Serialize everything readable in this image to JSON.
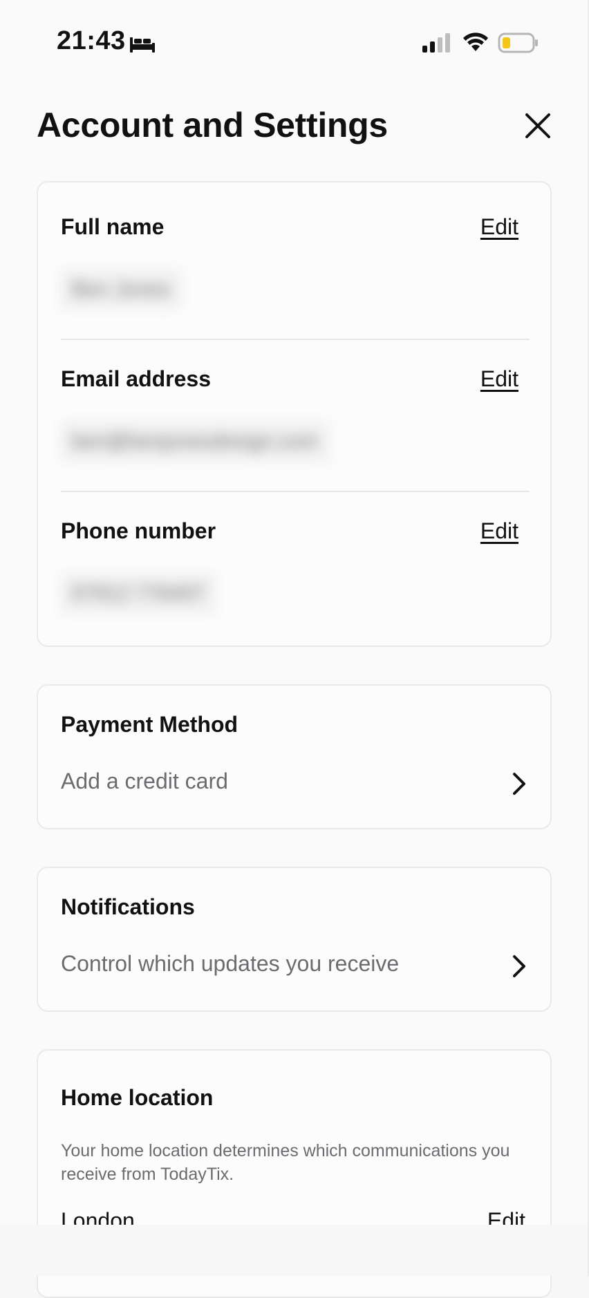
{
  "status_bar": {
    "time": "21:43",
    "icons": [
      "bed-icon",
      "cellular-signal-icon",
      "wifi-icon",
      "battery-icon"
    ],
    "battery_color": "#f5c518"
  },
  "header": {
    "title": "Account and Settings",
    "close_icon": "close-icon"
  },
  "profile": {
    "full_name": {
      "label": "Full name",
      "edit_label": "Edit",
      "value": "Ben Jones"
    },
    "email": {
      "label": "Email address",
      "edit_label": "Edit",
      "value": "ben@benjonesdesign.com"
    },
    "phone": {
      "label": "Phone number",
      "edit_label": "Edit",
      "value": "07912 776407"
    }
  },
  "payment": {
    "title": "Payment Method",
    "subtitle": "Add a credit card"
  },
  "notifications": {
    "title": "Notifications",
    "subtitle": "Control which updates you receive"
  },
  "home_location": {
    "title": "Home location",
    "description": "Your home location determines which communications you receive from TodayTix.",
    "value": "London",
    "edit_label": "Edit"
  }
}
